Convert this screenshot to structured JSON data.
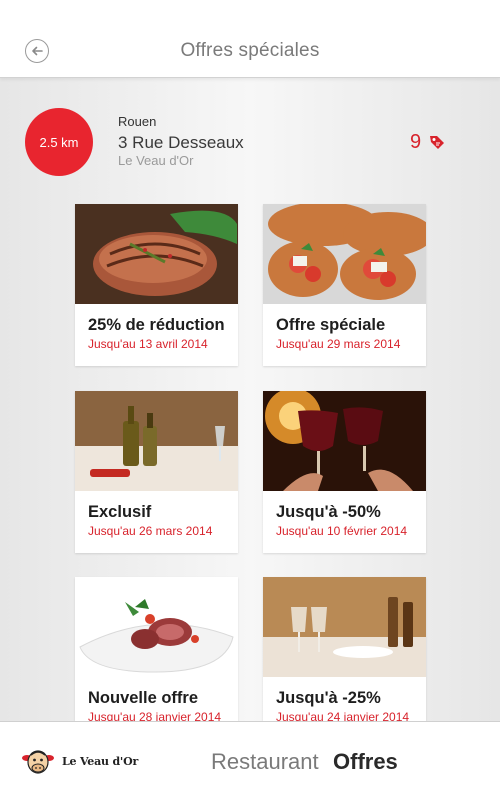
{
  "header": {
    "title": "Offres spéciales",
    "back_icon": "back-arrow-icon"
  },
  "location": {
    "distance": "2.5 km",
    "city": "Rouen",
    "street": "3 Rue Desseaux",
    "venue": "Le Veau d'Or",
    "offers_count": "9",
    "tag_icon": "price-tag-icon"
  },
  "offers": [
    {
      "title": "25% de réduction",
      "date": "Jusqu'au 13 avril 2014",
      "image": "steak-photo"
    },
    {
      "title": "Offre spéciale",
      "date": "Jusqu'au 29 mars 2014",
      "image": "bruschetta-photo"
    },
    {
      "title": "Exclusif",
      "date": "Jusqu'au 26 mars 2014",
      "image": "restaurant-table-photo"
    },
    {
      "title": "Jusqu'à -50%",
      "date": "Jusqu'au 10 février 2014",
      "image": "red-wine-toast-photo"
    },
    {
      "title": "Nouvelle offre",
      "date": "Jusqu'au 28 janvier 2014",
      "image": "lamb-dish-photo"
    },
    {
      "title": "Jusqu'à -25%",
      "date": "Jusqu'au 24 janvier 2014",
      "image": "wine-glasses-photo"
    }
  ],
  "bottom_bar": {
    "logo_text": "Le Veau d'Or",
    "tab_restaurant": "Restaurant",
    "tab_offres": "Offres",
    "active_tab": "Offres"
  },
  "colors": {
    "accent": "#e8252f",
    "date_red": "#d8232c",
    "header_bg": "#ffffff",
    "page_bg": "#ebebeb"
  }
}
